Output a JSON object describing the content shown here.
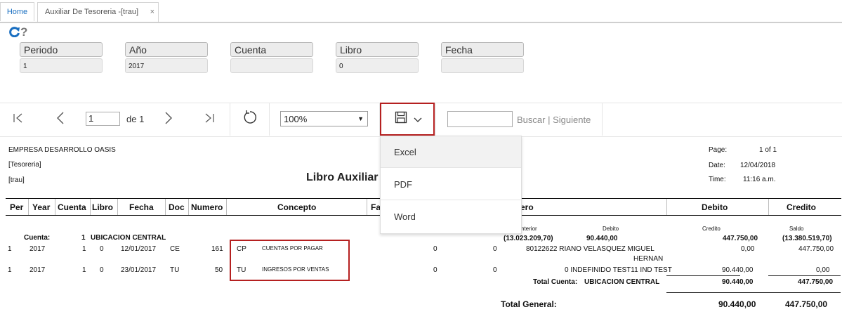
{
  "tabs": {
    "home": "Home",
    "active": "Auxiliar De Tesoreria -[trau]",
    "close": "×"
  },
  "icons": {
    "help": "?"
  },
  "filters": [
    {
      "label": "Periodo",
      "value": "1"
    },
    {
      "label": "Año",
      "value": "2017"
    },
    {
      "label": "Cuenta",
      "value": ""
    },
    {
      "label": "Libro",
      "value": "0"
    },
    {
      "label": "Fecha",
      "value": ""
    }
  ],
  "toolbar": {
    "page": "1",
    "of": "de 1",
    "zoom": "100%",
    "find": "Buscar",
    "sep": "|",
    "next": "Siguiente"
  },
  "export_menu": [
    "Excel",
    "PDF",
    "Word"
  ],
  "report": {
    "company": "EMPRESA DESARROLLO OASIS",
    "module": "[Tesoreria]",
    "user": "[trau]",
    "title": "Libro Auxiliar",
    "page_label": "Page:",
    "page_value": "1 of 1",
    "date_label": "Date:",
    "date_value": "12/04/2018",
    "time_label": "Time:",
    "time_value": "11:16 a.m.",
    "columns": [
      "Per",
      "Year",
      "Cuenta",
      "Libro",
      "Fecha",
      "Doc",
      "Numero",
      "Concepto",
      "Fa",
      "ero",
      "Debito",
      "Credito"
    ],
    "account_label": "Cuenta:",
    "account_num": "1",
    "account_name": "UBICACION CENTRAL",
    "sub_headers": {
      "anterior": "nterior",
      "debito": "Debito",
      "credito": "Credito",
      "saldo": "Saldo"
    },
    "sub_values": {
      "anterior": "(13.023.209,70)",
      "debito": "90.440,00",
      "credito": "447.750,00",
      "saldo": "(13.380.519,70)"
    },
    "rows": [
      {
        "per": "1",
        "year": "2017",
        "cuenta": "1",
        "libro": "0",
        "fecha": "12/01/2017",
        "doc": "CE",
        "numero": "161",
        "code": "CP",
        "concepto": "CUENTAS POR PAGAR",
        "c1": "0",
        "c2": "0",
        "tercero": "80122622 RIANO VELASQUEZ MIGUEL",
        "tercero2": "HERNAN",
        "debito": "0,00",
        "credito": "447.750,00"
      },
      {
        "per": "1",
        "year": "2017",
        "cuenta": "1",
        "libro": "0",
        "fecha": "23/01/2017",
        "doc": "TU",
        "numero": "50",
        "code": "TU",
        "concepto": "INGRESOS POR VENTAS",
        "c1": "0",
        "c2": "0",
        "tercero": "0 INDEFINIDO TEST11 IND TEST",
        "tercero2": "",
        "debito": "90.440,00",
        "credito": "0,00"
      }
    ],
    "total_cuenta_label": "Total Cuenta:",
    "total_cuenta_name": "UBICACION CENTRAL",
    "total_cuenta_debito": "90.440,00",
    "total_cuenta_credito": "447.750,00",
    "total_general_label": "Total General:",
    "total_general_debito": "90.440,00",
    "total_general_credito": "447.750,00"
  },
  "colors": {
    "accent": "#1a6fc1",
    "highlight": "#b52020"
  }
}
